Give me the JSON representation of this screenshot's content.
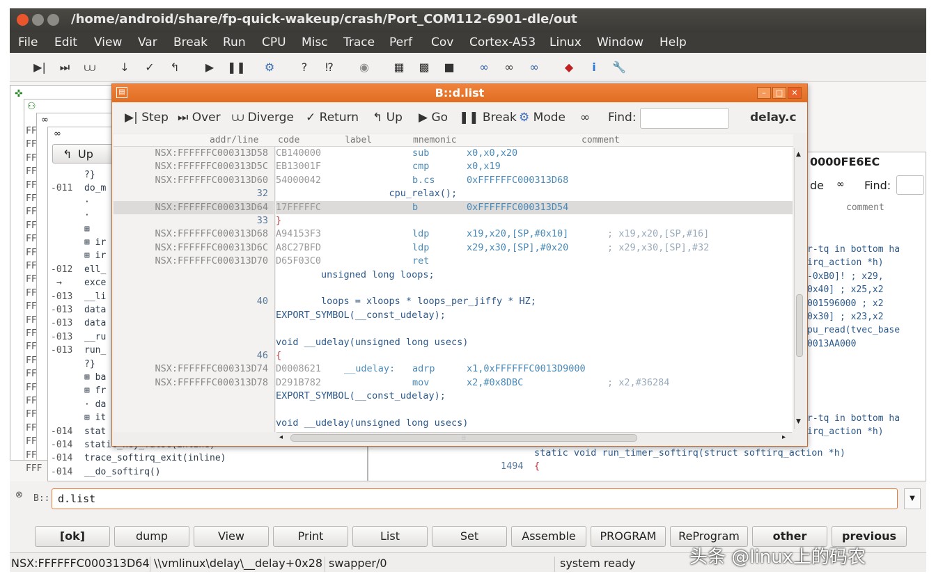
{
  "window": {
    "title": "/home/android/share/fp-quick-wakeup/crash/Port_COM112-6901-dle/out"
  },
  "menu": [
    "File",
    "Edit",
    "View",
    "Var",
    "Break",
    "Run",
    "CPU",
    "Misc",
    "Trace",
    "Perf",
    "Cov",
    "Cortex-A53",
    "Linux",
    "Window",
    "Help"
  ],
  "toolbar_icons": [
    "step-icon",
    "over-icon",
    "diverge-icon",
    "down-arrow-icon",
    "return-icon",
    "up-icon",
    "go-icon",
    "break-icon",
    "mode-icon",
    "help-icon",
    "context-help-icon",
    "stop-icon",
    "grid-icon",
    "grid2-icon",
    "square-icon",
    "glasses-icon",
    "glasses2-icon",
    "glasses3-icon",
    "cube-icon",
    "info-icon",
    "wrench-icon"
  ],
  "bg_left": {
    "up_label": "Up",
    "gutter": [
      "",
      "-011",
      "",
      "",
      "",
      "",
      "",
      "-012",
      "",
      "-013",
      "-013",
      "-013",
      "-013",
      "-013",
      "",
      "",
      "",
      "",
      "",
      "-014",
      "-014",
      "-014",
      "-014"
    ],
    "code": [
      "?}",
      "do_m",
      "·",
      "·",
      "⊞",
      "⊞ ir",
      "⊞ ir",
      "ell_",
      "exce",
      "__li",
      "data",
      "data",
      "__ru",
      "run_",
      "?}",
      "⊞ ba",
      "⊞ fr",
      "· da",
      "⊞ it",
      "stat",
      "static_key_false(inline)",
      "trace_softirq_exit(inline)",
      "__do_softirq()"
    ],
    "fff": [
      "FFF",
      "FFF",
      "FFF",
      "FFF",
      "FFF",
      "FFF",
      "FFF",
      "FFF",
      "FFF",
      "FFF",
      "FFF",
      "FFF",
      "FFF",
      "FFF",
      "FFF",
      "FFF",
      "FFF",
      "FFF",
      "FFF",
      "FFF",
      "FFF",
      "FFF",
      "FFF",
      "FFF",
      "FFF",
      "FFF"
    ]
  },
  "bg_right": {
    "title_fragment": "0000FE6EC",
    "mode_fragment": "de",
    "find_label": "Find:",
    "comment_header": "comment",
    "lines": [
      "r-tq in bottom ha",
      "irq_action *h)",
      "-0xB0]!    ; x29,",
      "0x40]    ; x25,x2",
      "001596000   ; x2",
      "0x30]    ; x23,x2",
      "pu_read(tvec_base",
      "0013AA000",
      "r-tq in bottom ha",
      "irq_action *h)"
    ],
    "lower_lineno": "1494",
    "lower_src": "static void run_timer_softirq(struct softirq_action *h)",
    "lower_brace": "{"
  },
  "dialog": {
    "title": "B::d.list",
    "tools": {
      "step": "Step",
      "over": "Over",
      "diverge": "Diverge",
      "return": "Return",
      "up": "Up",
      "go": "Go",
      "break": "Break",
      "mode": "Mode",
      "find": "Find:",
      "file": "delay.c"
    },
    "headers": {
      "addr": "addr/line",
      "code": "code",
      "label": "label",
      "mnemonic": "mnemonic",
      "comment": "comment"
    },
    "rows": [
      {
        "addr": "NSX:FFFFFFC000313D58",
        "hex": "CB140000",
        "label": "",
        "mn": "sub",
        "op": "x0,x0,x20",
        "cmt": "",
        "src": "",
        "hl": false
      },
      {
        "addr": "NSX:FFFFFFC000313D5C",
        "hex": "EB13001F",
        "label": "",
        "mn": "cmp",
        "op": "x0,x19",
        "cmt": "",
        "src": "",
        "hl": false
      },
      {
        "addr": "NSX:FFFFFFC000313D60",
        "hex": "54000042",
        "label": "",
        "mn": "b.cs",
        "op": "0xFFFFFFC000313D68",
        "cmt": "",
        "src": "",
        "hl": false
      },
      {
        "addr": "32",
        "hex": "",
        "label": "",
        "mn": "",
        "op": "",
        "cmt": "",
        "src": "                    cpu_relax();",
        "hl": false
      },
      {
        "addr": "NSX:FFFFFFC000313D64",
        "hex": "17FFFFFC",
        "label": "",
        "mn": "b",
        "op": "0xFFFFFFC000313D54",
        "cmt": "",
        "src": "",
        "hl": true
      },
      {
        "addr": "33",
        "hex": "",
        "label": "",
        "mn": "",
        "op": "",
        "cmt": "",
        "src": "}",
        "hl": false
      },
      {
        "addr": "NSX:FFFFFFC000313D68",
        "hex": "A94153F3",
        "label": "",
        "mn": "ldp",
        "op": "x19,x20,[SP,#0x10]",
        "cmt": "; x19,x20,[SP,#16]",
        "src": "",
        "hl": false
      },
      {
        "addr": "NSX:FFFFFFC000313D6C",
        "hex": "A8C27BFD",
        "label": "",
        "mn": "ldp",
        "op": "x29,x30,[SP],#0x20",
        "cmt": "; x29,x30,[SP],#32",
        "src": "",
        "hl": false
      },
      {
        "addr": "NSX:FFFFFFC000313D70",
        "hex": "D65F03C0",
        "label": "",
        "mn": "ret",
        "op": "",
        "cmt": "",
        "src": "",
        "hl": false
      },
      {
        "addr": "",
        "hex": "",
        "label": "",
        "mn": "",
        "op": "",
        "cmt": "",
        "src": "        unsigned long loops;",
        "hl": false
      },
      {
        "addr": "",
        "hex": "",
        "label": "",
        "mn": "",
        "op": "",
        "cmt": "",
        "src": "",
        "hl": false
      },
      {
        "addr": "40",
        "hex": "",
        "label": "",
        "mn": "",
        "op": "",
        "cmt": "",
        "src": "        loops = xloops * loops_per_jiffy * HZ;",
        "hl": false
      },
      {
        "addr": "",
        "hex": "",
        "label": "",
        "mn": "",
        "op": "",
        "cmt": "",
        "src": "EXPORT_SYMBOL(__const_udelay);",
        "hl": false
      },
      {
        "addr": "",
        "hex": "",
        "label": "",
        "mn": "",
        "op": "",
        "cmt": "",
        "src": "",
        "hl": false
      },
      {
        "addr": "",
        "hex": "",
        "label": "",
        "mn": "",
        "op": "",
        "cmt": "",
        "src": "void __udelay(unsigned long usecs)",
        "hl": false
      },
      {
        "addr": "46",
        "hex": "",
        "label": "",
        "mn": "",
        "op": "",
        "cmt": "",
        "src": "{",
        "hl": false
      },
      {
        "addr": "NSX:FFFFFFC000313D74",
        "hex": "D0008621",
        "label": "__udelay:",
        "mn": "adrp",
        "op": "x1,0xFFFFFFC0013D9000",
        "cmt": "",
        "src": "",
        "hl": false
      },
      {
        "addr": "NSX:FFFFFFC000313D78",
        "hex": "D291B782",
        "label": "",
        "mn": "mov",
        "op": "x2,#0x8DBC",
        "cmt": "; x2,#36284",
        "src": "",
        "hl": false
      },
      {
        "addr": "",
        "hex": "",
        "label": "",
        "mn": "",
        "op": "",
        "cmt": "",
        "src": "EXPORT_SYMBOL(__const_udelay);",
        "hl": false
      },
      {
        "addr": "",
        "hex": "",
        "label": "",
        "mn": "",
        "op": "",
        "cmt": "",
        "src": "",
        "hl": false
      },
      {
        "addr": "",
        "hex": "",
        "label": "",
        "mn": "",
        "op": "",
        "cmt": "",
        "src": "void __udelay(unsigned long usecs)",
        "hl": false
      }
    ],
    "hscroll_grip": "⦙⦙⦙"
  },
  "command": {
    "prompt": "B::",
    "value": "d.list"
  },
  "buttons": [
    "[ok]",
    "dump",
    "View",
    "Print",
    "List",
    "Set",
    "Assemble",
    "PROGRAM",
    "ReProgram",
    "other",
    "previous"
  ],
  "status": {
    "address": "NSX:FFFFFFC000313D64",
    "symbol": "\\\\vmlinux\\delay\\__delay+0x28",
    "task": "swapper/0",
    "state": "system ready"
  },
  "watermark": "头条 @linux上的码农"
}
